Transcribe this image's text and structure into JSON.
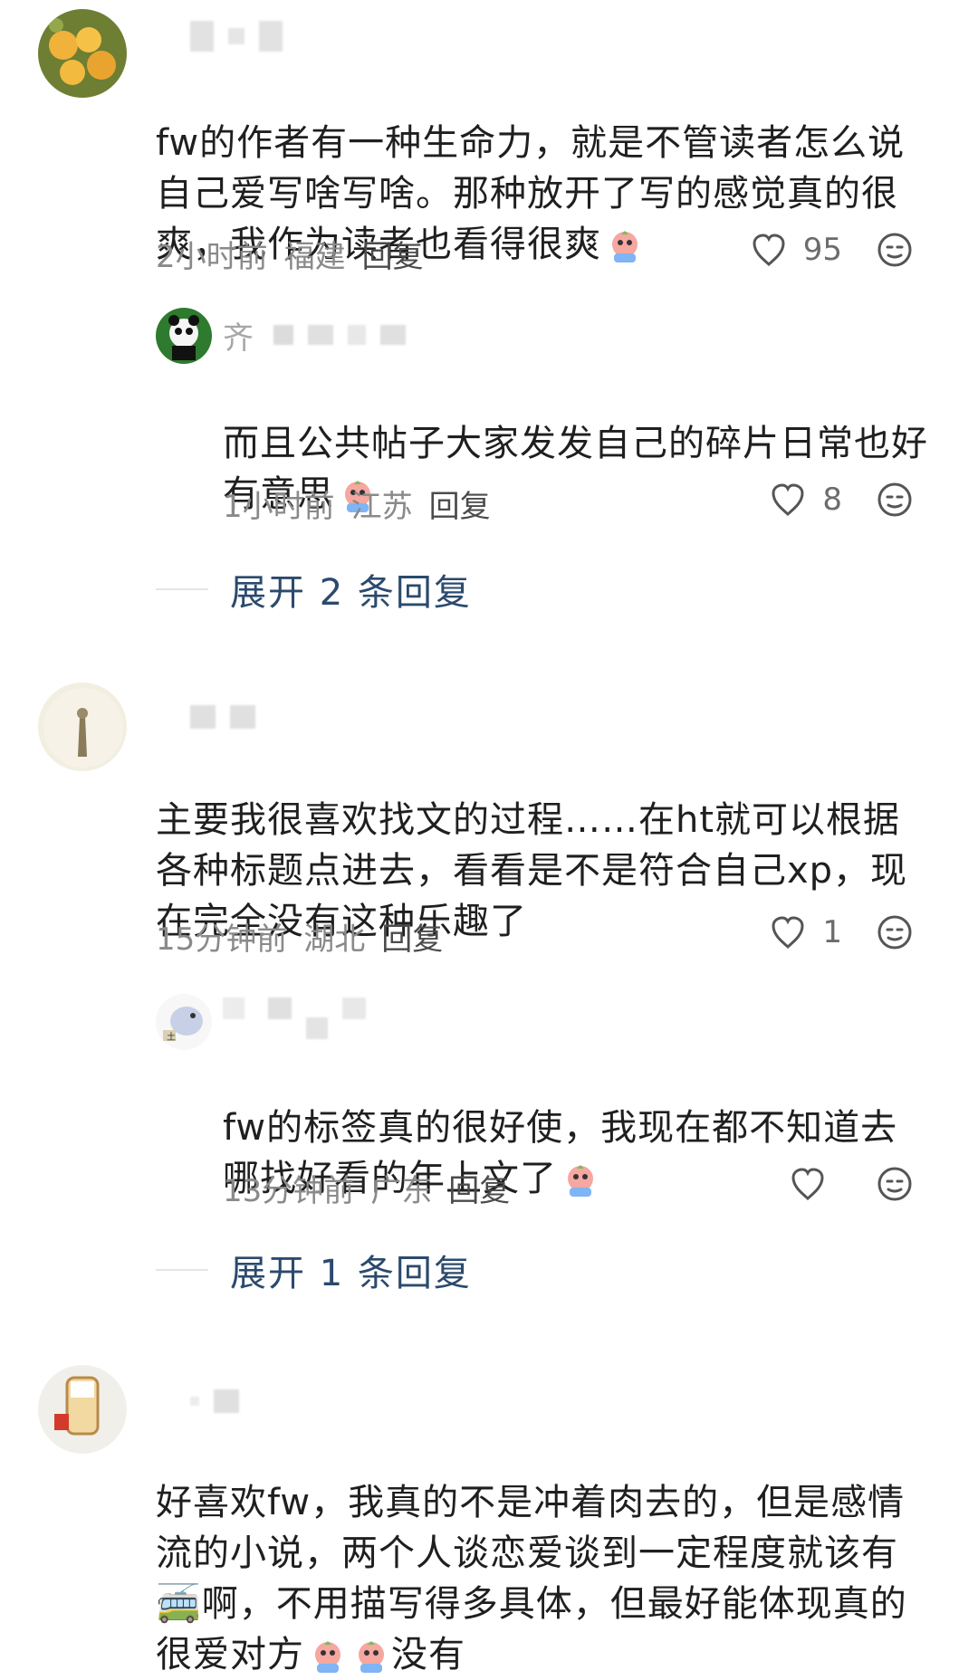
{
  "comments": [
    {
      "text": "fw的作者有一种生命力，就是不管读者怎么说自己爱写啥写啥。那种放开了写的感觉真的很爽，我作为读者也看得很爽",
      "time": "2小时前",
      "location": "福建",
      "reply": "回复",
      "likes": "95",
      "reply_item": {
        "name_first_char": "齐",
        "text": "而且公共帖子大家发发自己的碎片日常也好有意思",
        "time": "1小时前",
        "location": "江苏",
        "reply": "回复",
        "likes": "8"
      },
      "expand": "展开 2 条回复"
    },
    {
      "text": "主要我很喜欢找文的过程……在ht就可以根据各种标题点进去，看看是不是符合自己xp，现在完全没有这种乐趣了",
      "time": "15分钟前",
      "location": "湖北",
      "reply": "回复",
      "likes": "1",
      "reply_item": {
        "text": "fw的标签真的很好使，我现在都不知道去哪找好看的年上文了",
        "time": "13分钟前",
        "location": "广东",
        "reply": "回复",
        "likes": ""
      },
      "expand": "展开 1 条回复"
    },
    {
      "text": "好喜欢fw，我真的不是冲着肉去的，但是感情流的小说，两个人谈恋爱谈到一定程度就该有🚎啊，不用描写得多具体，但最好能体现真的很爱对方",
      "tail": "没有"
    }
  ],
  "colors": {
    "accent_link": "#2b4a6d",
    "meta_gray": "#8a8a8a",
    "text": "#1f1f1f"
  },
  "icons": {
    "like": "heart-outline-icon",
    "more": "emoji-face-icon"
  }
}
